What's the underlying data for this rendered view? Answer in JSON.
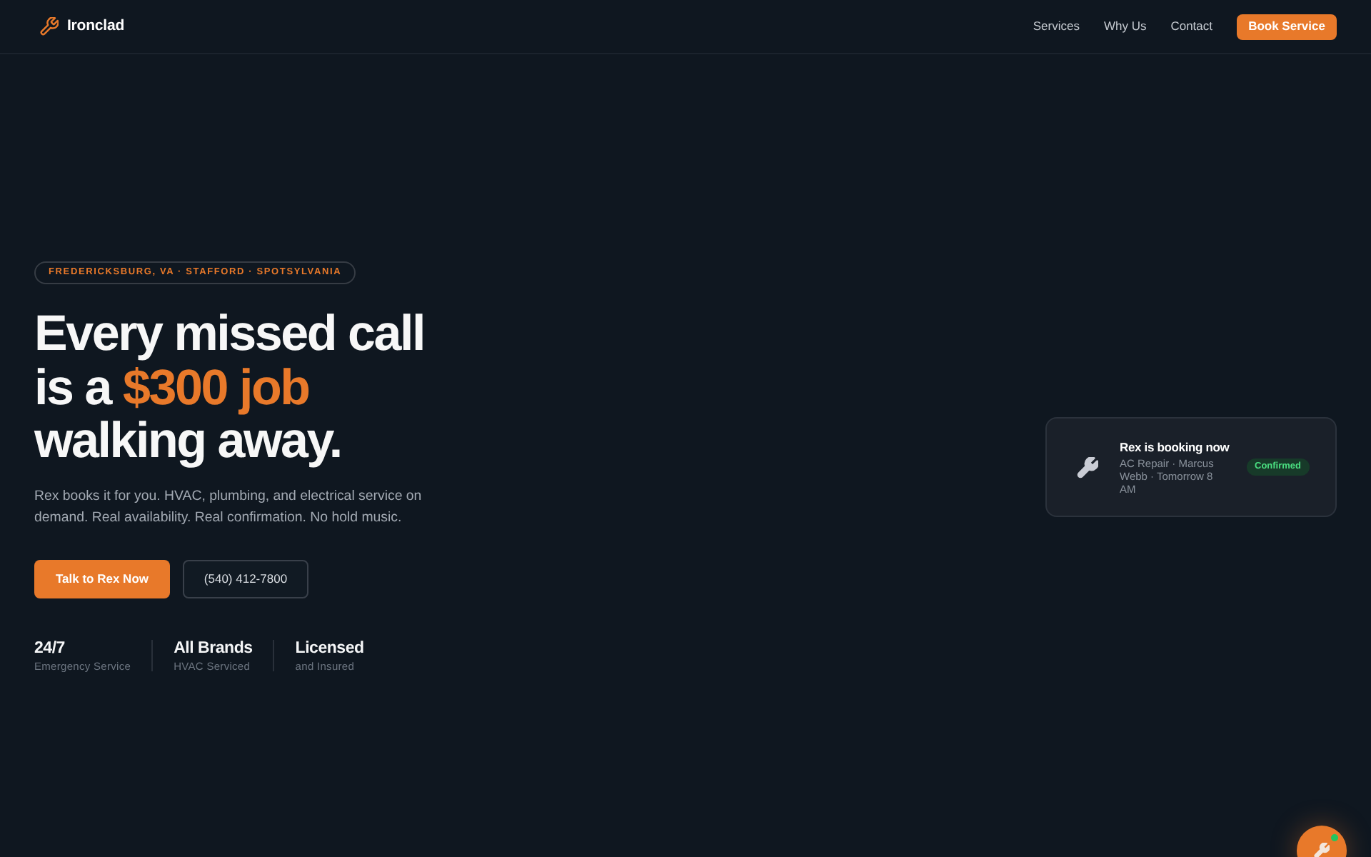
{
  "header": {
    "brand": "Ironclad",
    "nav": [
      "Services",
      "Why Us",
      "Contact"
    ],
    "cta": "Book Service"
  },
  "hero": {
    "badge": "FREDERICKSBURG, VA · STAFFORD · SPOTSYLVANIA",
    "headline": [
      [
        {
          "text": "Every missed call",
          "accent": false
        }
      ],
      [
        {
          "text": "is a ",
          "accent": false
        },
        {
          "text": "$300 job",
          "accent": true
        }
      ],
      [
        {
          "text": "walking away.",
          "accent": false
        }
      ]
    ],
    "description": "Rex books it for you. HVAC, plumbing, and electrical service on demand. Real availability. Real confirmation. No hold music.",
    "buttons": [
      {
        "label": "Talk to Rex Now",
        "kind": "primary"
      },
      {
        "label": "(540) 412-7800",
        "kind": "secondary"
      }
    ],
    "stats": [
      {
        "value": "24/7",
        "caption": "Emergency Service"
      },
      {
        "value": "All Brands",
        "caption": "HVAC Serviced"
      },
      {
        "value": "Licensed",
        "caption": "and Insured"
      }
    ]
  },
  "booking_card": {
    "title": "Rex is booking now",
    "detail": "AC Repair · Marcus Webb · Tomorrow 8 AM",
    "status": "Confirmed"
  },
  "chat_button": {
    "online": true
  }
}
